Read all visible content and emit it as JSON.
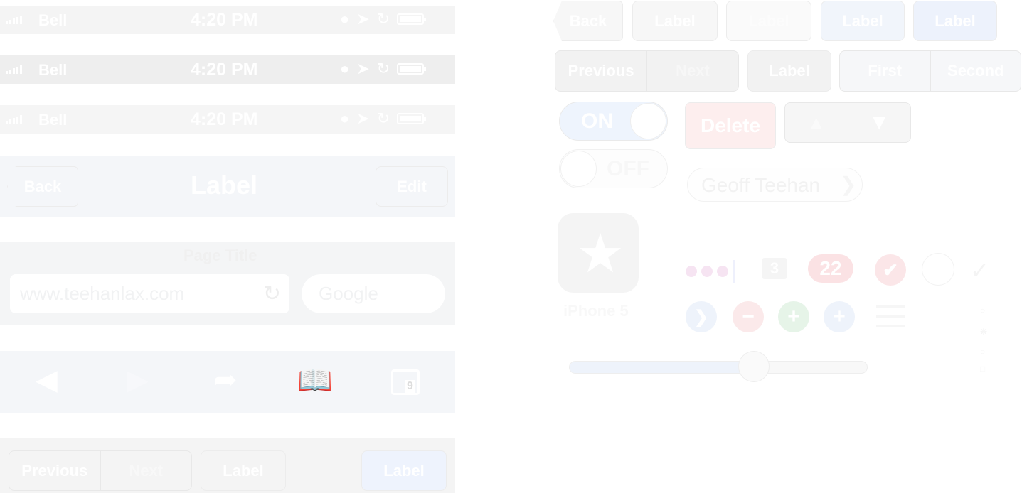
{
  "status_bars": [
    {
      "carrier": "Bell",
      "time": "4:20 PM"
    },
    {
      "carrier": "Bell",
      "time": "4:20 PM"
    },
    {
      "carrier": "Bell",
      "time": "4:20 PM"
    }
  ],
  "navbar": {
    "back_label": "Back",
    "title": "Label",
    "edit_label": "Edit"
  },
  "urlbar": {
    "page_title": "Page Title",
    "url_value": "www.teehanlax.com",
    "search_placeholder": "Google"
  },
  "toolbar": {
    "tabs_count": "9"
  },
  "bottombar": {
    "previous_label": "Previous",
    "next_label": "Next",
    "label1": "Label",
    "label2": "Label"
  },
  "top_buttons": {
    "back": "Back",
    "label1": "Label",
    "label2": "Label",
    "label3": "Label",
    "label4": "Label"
  },
  "segments_row": {
    "previous": "Previous",
    "next": "Next",
    "label": "Label",
    "first": "First",
    "second": "Second"
  },
  "switches": {
    "on_label": "ON",
    "off_label": "OFF"
  },
  "delete_label": "Delete",
  "contact_name": "Geoff Teehan",
  "app_icon": {
    "label": "iPhone 5"
  },
  "badges": {
    "count_small": "3",
    "count_large": "22"
  },
  "colors": {
    "accent_blue": "#eef4fd",
    "delete_red": "#fdeeee",
    "badge_red": "#fbe2e4",
    "add_green": "#e6f4e8",
    "page_dots": "#f6e4f2"
  }
}
